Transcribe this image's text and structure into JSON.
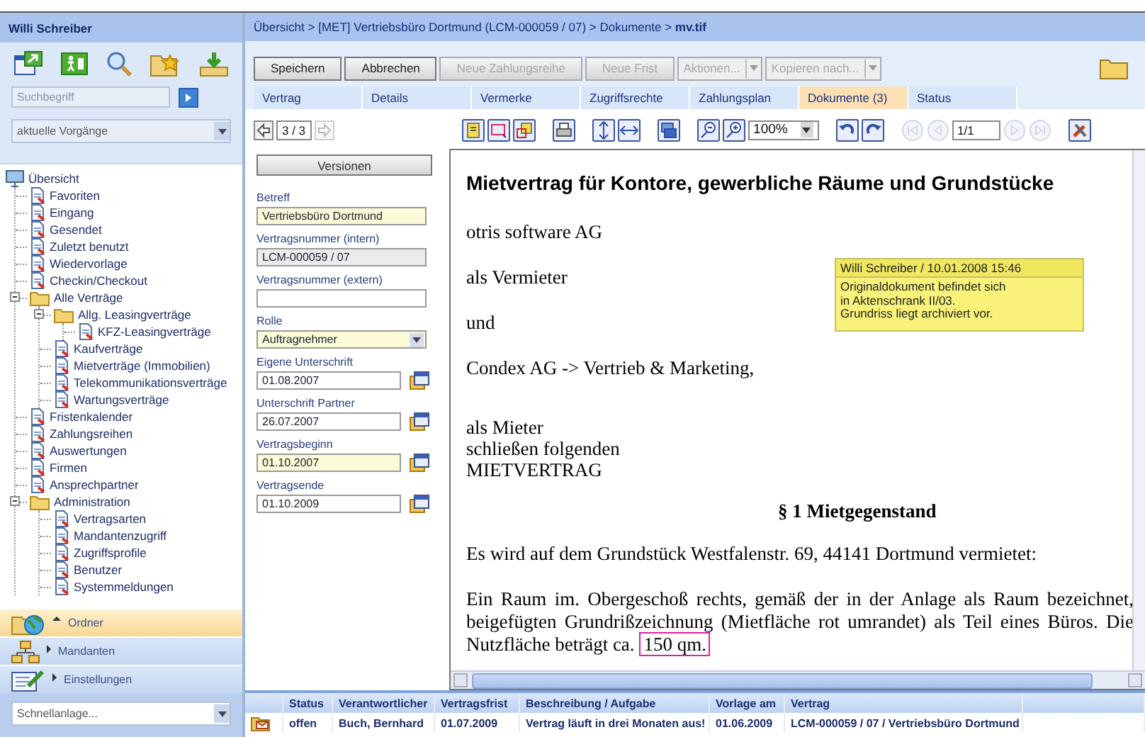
{
  "sidebar": {
    "user": "Willi Schreiber",
    "search": {
      "placeholder": "Suchbegriff"
    },
    "filter": "aktuelle Vorgänge",
    "tree": [
      {
        "label": "Übersicht",
        "children": [
          {
            "label": "Favoriten"
          },
          {
            "label": "Eingang"
          },
          {
            "label": "Gesendet"
          },
          {
            "label": "Zuletzt benutzt"
          },
          {
            "label": "Wiedervorlage"
          },
          {
            "label": "Checkin/Checkout"
          },
          {
            "label": "Alle Verträge",
            "expanded": true,
            "children": [
              {
                "label": "Allg. Leasingverträge",
                "expanded": true,
                "children": [
                  {
                    "label": "KFZ-Leasingverträge"
                  }
                ]
              },
              {
                "label": "Kaufverträge"
              },
              {
                "label": "Mietverträge (Immobilien)"
              },
              {
                "label": "Telekommunikationsverträge"
              },
              {
                "label": "Wartungsverträge"
              }
            ]
          },
          {
            "label": "Fristenkalender"
          },
          {
            "label": "Zahlungsreihen"
          },
          {
            "label": "Auswertungen"
          },
          {
            "label": "Firmen"
          },
          {
            "label": "Ansprechpartner"
          },
          {
            "label": "Administration",
            "expanded": true,
            "children": [
              {
                "label": "Vertragsarten"
              },
              {
                "label": "Mandantenzugriff"
              },
              {
                "label": "Zugriffsprofile"
              },
              {
                "label": "Benutzer"
              },
              {
                "label": "Systemmeldungen"
              }
            ]
          }
        ]
      }
    ],
    "sections": [
      {
        "label": "Ordner",
        "selected": true
      },
      {
        "label": "Mandanten",
        "selected": false
      },
      {
        "label": "Einstellungen",
        "selected": false
      }
    ],
    "quick_create": "Schnellanlage..."
  },
  "breadcrumb": "Übersicht > [MET] Vertriebsbüro Dortmund (LCM-000059 / 07) > Dokumente > **mv.tif**",
  "actions": [
    {
      "kind": "button",
      "label": "Speichern",
      "disabled": false
    },
    {
      "kind": "button",
      "label": "Abbrechen",
      "disabled": false
    },
    {
      "kind": "button",
      "label": "Neue Zahlungsreihe",
      "disabled": true
    },
    {
      "kind": "button",
      "label": "Neue Frist",
      "disabled": true
    },
    {
      "kind": "dropdown",
      "label": "Aktionen...",
      "disabled": true
    },
    {
      "kind": "dropdown",
      "label": "Kopieren nach...",
      "disabled": true
    }
  ],
  "tabs": [
    {
      "label": "Vertrag",
      "selected": false
    },
    {
      "label": "Details",
      "selected": false
    },
    {
      "label": "Vermerke",
      "selected": false
    },
    {
      "label": "Zugriffsrechte",
      "selected": false
    },
    {
      "label": "Zahlungsplan",
      "selected": false
    },
    {
      "label": "Dokumente (3)",
      "selected": true
    },
    {
      "label": "Status",
      "selected": false
    }
  ],
  "viewer_toolbar": {
    "documents": {
      "value": "3 / 3",
      "prev_disabled": false,
      "next_disabled": true
    },
    "zoom": "100%",
    "page": {
      "value": "1/1",
      "nav_disabled": true
    }
  },
  "form": {
    "button": "Versionen",
    "fields": [
      {
        "kind": "text",
        "label": "Betreff",
        "value": "Vertriebsbüro Dortmund",
        "required": true,
        "readonly": false
      },
      {
        "kind": "text",
        "label": "Vertragsnummer (intern)",
        "value": "LCM-000059 / 07",
        "required": false,
        "readonly": true
      },
      {
        "kind": "text",
        "label": "Vertragsnummer (extern)",
        "required": false,
        "readonly": false
      },
      {
        "kind": "select",
        "label": "Rolle",
        "value": "Auftragnehmer",
        "required": true,
        "readonly": false
      },
      {
        "kind": "date",
        "label": "Eigene Unterschrift",
        "value": "01.08.2007",
        "required": false,
        "readonly": false
      },
      {
        "kind": "date",
        "label": "Unterschrift Partner",
        "value": "26.07.2007",
        "required": false,
        "readonly": false
      },
      {
        "kind": "date",
        "label": "Vertragsbeginn",
        "value": "01.10.2007",
        "required": true,
        "readonly": false
      },
      {
        "kind": "date",
        "label": "Vertragsende",
        "value": "01.10.2009",
        "required": false,
        "readonly": false
      }
    ]
  },
  "document": {
    "blocks": [
      {
        "kind": "title",
        "text": "Mietvertrag für Kontore, gewerbliche Räume und Grundstücke"
      },
      {
        "kind": "para",
        "text": "otris software AG"
      },
      {
        "kind": "para",
        "text": "als Vermieter"
      },
      {
        "kind": "para",
        "text": "und"
      },
      {
        "kind": "para",
        "text": "Condex AG -> Vertrieb & Marketing,"
      },
      {
        "kind": "line",
        "text": "als Mieter"
      },
      {
        "kind": "line",
        "text": "schließen folgenden"
      },
      {
        "kind": "line",
        "text": "MIETVERTRAG"
      },
      {
        "kind": "heading",
        "text": "§ 1 Mietgegenstand"
      },
      {
        "kind": "para",
        "text": "Es wird auf dem Grundstück Westfalenstr. 69, 44141 Dortmund vermietet:"
      },
      {
        "kind": "para",
        "text": "Ein Raum im. Obergeschoß rechts, gemäß der in der Anlage als Raum bezeichnet, beigefügten Grundrißzeichnung (Mietfläche rot umrandet) als Teil eines Büros. Die Nutzfläche beträgt ca.",
        "highlight": "150 qm."
      }
    ],
    "note": {
      "header": "Willi Schreiber / 10.01.2008 15:46",
      "text": "Originaldokument befindet sich\nin Aktenschrank II/03.\nGrundriss liegt archiviert vor."
    }
  },
  "tasks": {
    "columns": [
      "Status",
      "Verantwortlicher",
      "Vertragsfrist",
      "Beschreibung / Aufgabe",
      "Vorlage am",
      "Vertrag"
    ],
    "rows": [
      {
        "cells": [
          "offen",
          "Buch, Bernhard",
          "01.07.2009",
          "Vertrag läuft in drei Monaten aus!",
          "01.06.2009",
          "LCM-000059 / 07 / Vertriebsbüro Dortmund"
        ]
      }
    ]
  }
}
